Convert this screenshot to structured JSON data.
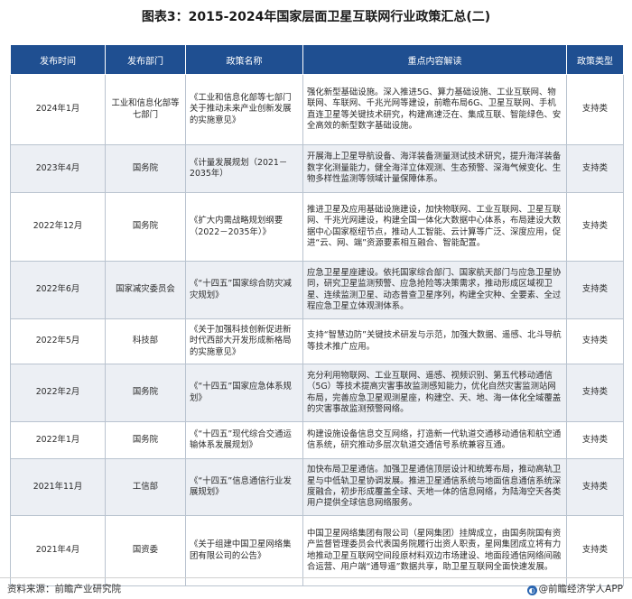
{
  "title": "图表3：2015-2024年国家层面卫星互联网行业政策汇总(二)",
  "table": {
    "headers": [
      "发布时间",
      "发布部门",
      "政策名称",
      "重点内容解读",
      "政策类型"
    ],
    "rows": [
      {
        "date": "2024年1月",
        "dept": "工业和信息化部等七部门",
        "name": "《工业和信息化部等七部门关于推动未来产业创新发展的实施意见》",
        "content": "强化新型基础设施。深入推进5G、算力基础设施、工业互联网、物联网、车联网、千兆光网等建设，前瞻布局6G、卫星互联网、手机直连卫星等关键技术研究，构建高速泛在、集成互联、智能绿色、安全高效的新型数字基础设施。",
        "type": "支持类"
      },
      {
        "date": "2023年4月",
        "dept": "国务院",
        "name": "《计量发展规划（2021－2035年）",
        "content": "开展海上卫星导航设备、海洋装备测量测试技术研究，提升海洋装备数字化测量能力，健全海洋立体观测、生态预警、深海气候变化、生物多样性监测等领域计量保障体系。",
        "type": "支持类"
      },
      {
        "date": "2022年12月",
        "dept": "国务院",
        "name": "《扩大内需战略规划纲要（2022－2035年）》",
        "content": "推进卫星及应用基础设施建设，加快物联网、工业互联网、卫星互联网、千兆光网建设，构建全国一体化大数据中心体系，布局建设大数据中心国家枢纽节点，推动人工智能、云计算等广泛、深度应用，促进“云、网、端”资源要素相互融合、智能配置。",
        "type": "支持类"
      },
      {
        "date": "2022年6月",
        "dept": "国家减灾委员会",
        "name": "《“十四五”国家综合防灾减灾规划》",
        "content": "应急卫星星座建设。依托国家综合部门、国家航天部门与应急卫星协同，研究卫星监测预警、应急抢险等决策需求，推动形成区域视卫星、连续监测卫星、动态普查卫星序列，构建全灾种、全要素、全过程应急卫星立体观测体系。",
        "type": "支持类"
      },
      {
        "date": "2022年5月",
        "dept": "科技部",
        "name": "《关于加强科技创新促进新时代西部大开发形成新格局的实施意见》",
        "content": "支持“智慧边防”关键技术研发与示范，加强大数据、遥感、北斗导航等技术推广应用。",
        "type": "支持类"
      },
      {
        "date": "2022年2月",
        "dept": "国务院",
        "name": "《“十四五”国家应急体系规划》",
        "content": "充分利用物联网、工业互联网、遥感、视频识别、第五代移动通信（5G）等技术提高灾害事故监测感知能力，优化自然灾害监测站网布局，完善应急卫星观测星座，构建空、天、地、海一体化全域覆盖的灾害事故监测预警网络。",
        "type": "支持类"
      },
      {
        "date": "2022年1月",
        "dept": "国务院",
        "name": "《“十四五”现代综合交通运输体系发展规划》",
        "content": "构建设施设备信息交互网络，打造新一代轨道交通移动通信和航空通信系统，研究推动多层次轨道交通信号系统兼容互通。",
        "type": "支持类"
      },
      {
        "date": "2021年11月",
        "dept": "工信部",
        "name": "《“十四五”信息通信行业发展规划》",
        "content": "加快布局卫星通信。加强卫星通信顶层设计和统筹布局，推动高轨卫星与中低轨卫星协调发展。推进卫星通信系统与地面信息通信系统深度融合，初步形成覆盖全球、天地一体的信息网络，为陆海空天各类用户提供全球信息网络服务。",
        "type": "支持类"
      },
      {
        "date": "2021年4月",
        "dept": "国资委",
        "name": "《关于组建中国卫星网络集团有限公司的公告》",
        "content": "中国卫星网络集团有限公司（星网集团）挂牌成立，由国务院国有资产监督管理委员会代表国务院履行出资人职责，星网集团成立将有力地推动卫星互联网空间段原材料双边市场建设、地面段通信网络间融合运营、用户端“通导遥”数据共享，助卫星互联网全面快速发展。",
        "type": "支持类"
      }
    ]
  },
  "footer": {
    "source": "资料来源：前瞻产业研究院",
    "brand": "@前瞻经济学人APP"
  }
}
